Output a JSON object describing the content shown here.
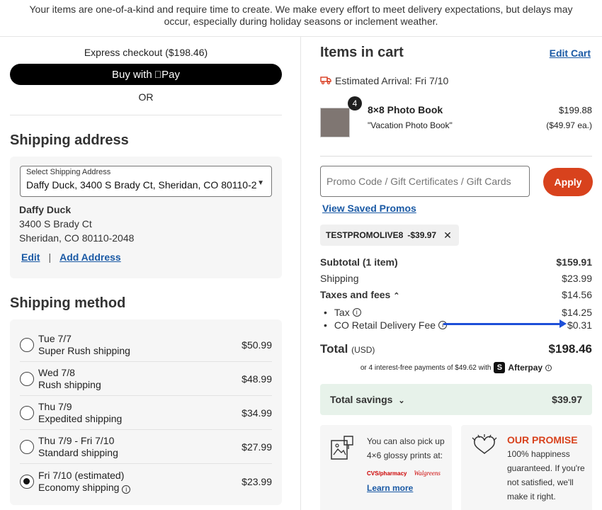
{
  "banner": "Your items are one-of-a-kind and require time to create. We make every effort to meet delivery expectations, but delays may occur, especially during holiday seasons or inclement weather.",
  "express": {
    "label": "Express checkout ($198.46)",
    "buy_with": "Buy with",
    "pay": "Pay",
    "or": "OR"
  },
  "shipping_address": {
    "title": "Shipping address",
    "select_label": "Select Shipping Address",
    "select_value": "Daffy Duck, 3400 S Brady Ct, Sheridan, CO 80110-2048",
    "name": "Daffy Duck",
    "street": "3400 S Brady Ct",
    "city": "Sheridan, CO 80110-2048",
    "edit": "Edit",
    "separator": "|",
    "add": "Add Address"
  },
  "shipping_method": {
    "title": "Shipping method",
    "options": [
      {
        "date": "Tue 7/7",
        "name": "Super Rush shipping",
        "price": "$50.99",
        "selected": false
      },
      {
        "date": "Wed 7/8",
        "name": "Rush shipping",
        "price": "$48.99",
        "selected": false
      },
      {
        "date": "Thu 7/9",
        "name": "Expedited shipping",
        "price": "$34.99",
        "selected": false
      },
      {
        "date": "Thu 7/9 - Fri 7/10",
        "name": "Standard shipping",
        "price": "$27.99",
        "selected": false
      },
      {
        "date": "Fri 7/10 (estimated)",
        "name": "Economy shipping",
        "price": "$23.99",
        "selected": true
      }
    ]
  },
  "cart": {
    "title": "Items in cart",
    "edit": "Edit Cart",
    "arrival": "Estimated Arrival: Fri 7/10",
    "item": {
      "qty": "4",
      "name": "8×8 Photo Book",
      "subtitle": "\"Vacation Photo Book\"",
      "price": "$199.88",
      "each": "($49.97 ea.)"
    },
    "promo_placeholder": "Promo Code / Gift Certificates / Gift Cards",
    "apply": "Apply",
    "view_promos": "View Saved Promos",
    "applied_code": "TESTPROMOLIVE8",
    "applied_discount": "-$39.97",
    "remove_glyph": "✕"
  },
  "summary": {
    "subtotal_label": "Subtotal (1 item)",
    "subtotal": "$159.91",
    "shipping_label": "Shipping",
    "shipping": "$23.99",
    "taxes_label": "Taxes and fees",
    "taxes": "$14.56",
    "tax_label": "Tax",
    "tax": "$14.25",
    "delivery_fee_label": "CO Retail Delivery Fee",
    "delivery_fee": "$0.31",
    "total_label": "Total",
    "total_currency": "(USD)",
    "total": "$198.46",
    "afterpay_text": "or 4 interest-free payments of $49.62 with",
    "afterpay_name": "Afterpay",
    "savings_label": "Total savings",
    "savings": "$39.97"
  },
  "cards": {
    "pickup_line1": "You can also pick up",
    "pickup_line2": "4×6 glossy prints at:",
    "cvs": "CVS/pharmacy",
    "walgreens": "Walgreens",
    "learn_more": "Learn more",
    "promise_title": "OUR PROMISE",
    "promise_l1": "100% happiness",
    "promise_l2": "guaranteed. If you're",
    "promise_l3": "not satisfied, we'll",
    "promise_l4": "make it right."
  },
  "colors": {
    "accent": "#d8421d",
    "link": "#1b5aa5",
    "savings_bg": "#e7f2ea",
    "annotation_arrow": "#1d4fd8"
  }
}
